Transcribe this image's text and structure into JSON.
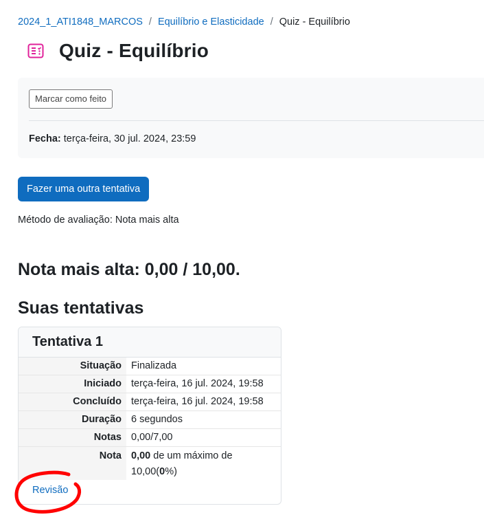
{
  "breadcrumb": {
    "course": "2024_1_ATI1848_MARCOS",
    "section": "Equilíbrio e Elasticidade",
    "current": "Quiz - Equilíbrio",
    "separator": "/"
  },
  "header": {
    "title": "Quiz - Equilíbrio",
    "icon": "quiz-icon",
    "icon_color": "#e0219a"
  },
  "activity": {
    "mark_done_label": "Marcar como feito",
    "close_label": "Fecha:",
    "close_value": "terça-feira, 30 jul. 2024, 23:59"
  },
  "actions": {
    "reattempt_label": "Fazer uma outra tentativa"
  },
  "grading": {
    "method": "Método de avaliação: Nota mais alta",
    "highest_grade": "Nota mais alta: 0,00 / 10,00."
  },
  "attempts": {
    "heading": "Suas tentativas",
    "items": [
      {
        "title": "Tentativa 1",
        "rows": [
          {
            "label": "Situação",
            "value": "Finalizada"
          },
          {
            "label": "Iniciado",
            "value": "terça-feira, 16 jul. 2024, 19:58"
          },
          {
            "label": "Concluído",
            "value": "terça-feira, 16 jul. 2024, 19:58"
          },
          {
            "label": "Duração",
            "value": "6 segundos"
          },
          {
            "label": "Notas",
            "value": "0,00/7,00"
          }
        ],
        "grade": {
          "label": "Nota",
          "score": "0,00",
          "middle": " de um máximo de 10,00(",
          "percent": "0",
          "suffix": "%)"
        },
        "review_label": "Revisão"
      }
    ]
  },
  "colors": {
    "link": "#0f6cbf",
    "primary_button": "#0f6cbf",
    "annotation": "#ff0000"
  }
}
